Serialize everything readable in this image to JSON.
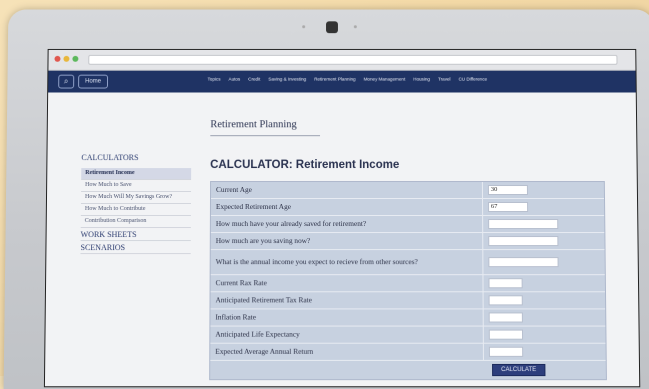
{
  "nav": {
    "home_label": "Home",
    "links": [
      "Topics",
      "Autos",
      "Credit",
      "Saving & Investing",
      "Retirement Planning",
      "Money Management",
      "Housing",
      "Travel",
      "CU Difference"
    ]
  },
  "page": {
    "section_title": "Retirement Planning",
    "calc_title": "CALCULATOR: Retirement Income"
  },
  "sidebar": {
    "heading": "CALCULATORS",
    "items": [
      {
        "label": "Retirement Income",
        "active": true
      },
      {
        "label": "How Much to Save",
        "active": false
      },
      {
        "label": "How Much Will My Savings Grow?",
        "active": false
      },
      {
        "label": "How Much to Contribute",
        "active": false
      },
      {
        "label": "Contribution Comparison",
        "active": false
      }
    ],
    "worksheets": "WORK SHEETS",
    "scenarios": "SCENARIOS"
  },
  "form": {
    "fields": [
      {
        "label": "Current Age",
        "value": "30"
      },
      {
        "label": "Expected Retirement Age",
        "value": "67"
      },
      {
        "label": "How much have your already saved for retirement?",
        "value": ""
      },
      {
        "label": "How much are you saving now?",
        "value": ""
      },
      {
        "label": "What is the annual income you expect to recieve from other sources?",
        "value": ""
      },
      {
        "label": "Current Rax Rate",
        "value": ""
      },
      {
        "label": "Anticipated Retirement Tax Rate",
        "value": ""
      },
      {
        "label": "Inflation Rate",
        "value": ""
      },
      {
        "label": "Anticipated Life Expectancy",
        "value": ""
      },
      {
        "label": "Expected Average Annual Return",
        "value": ""
      }
    ],
    "calculate_label": "CALCULATE"
  }
}
